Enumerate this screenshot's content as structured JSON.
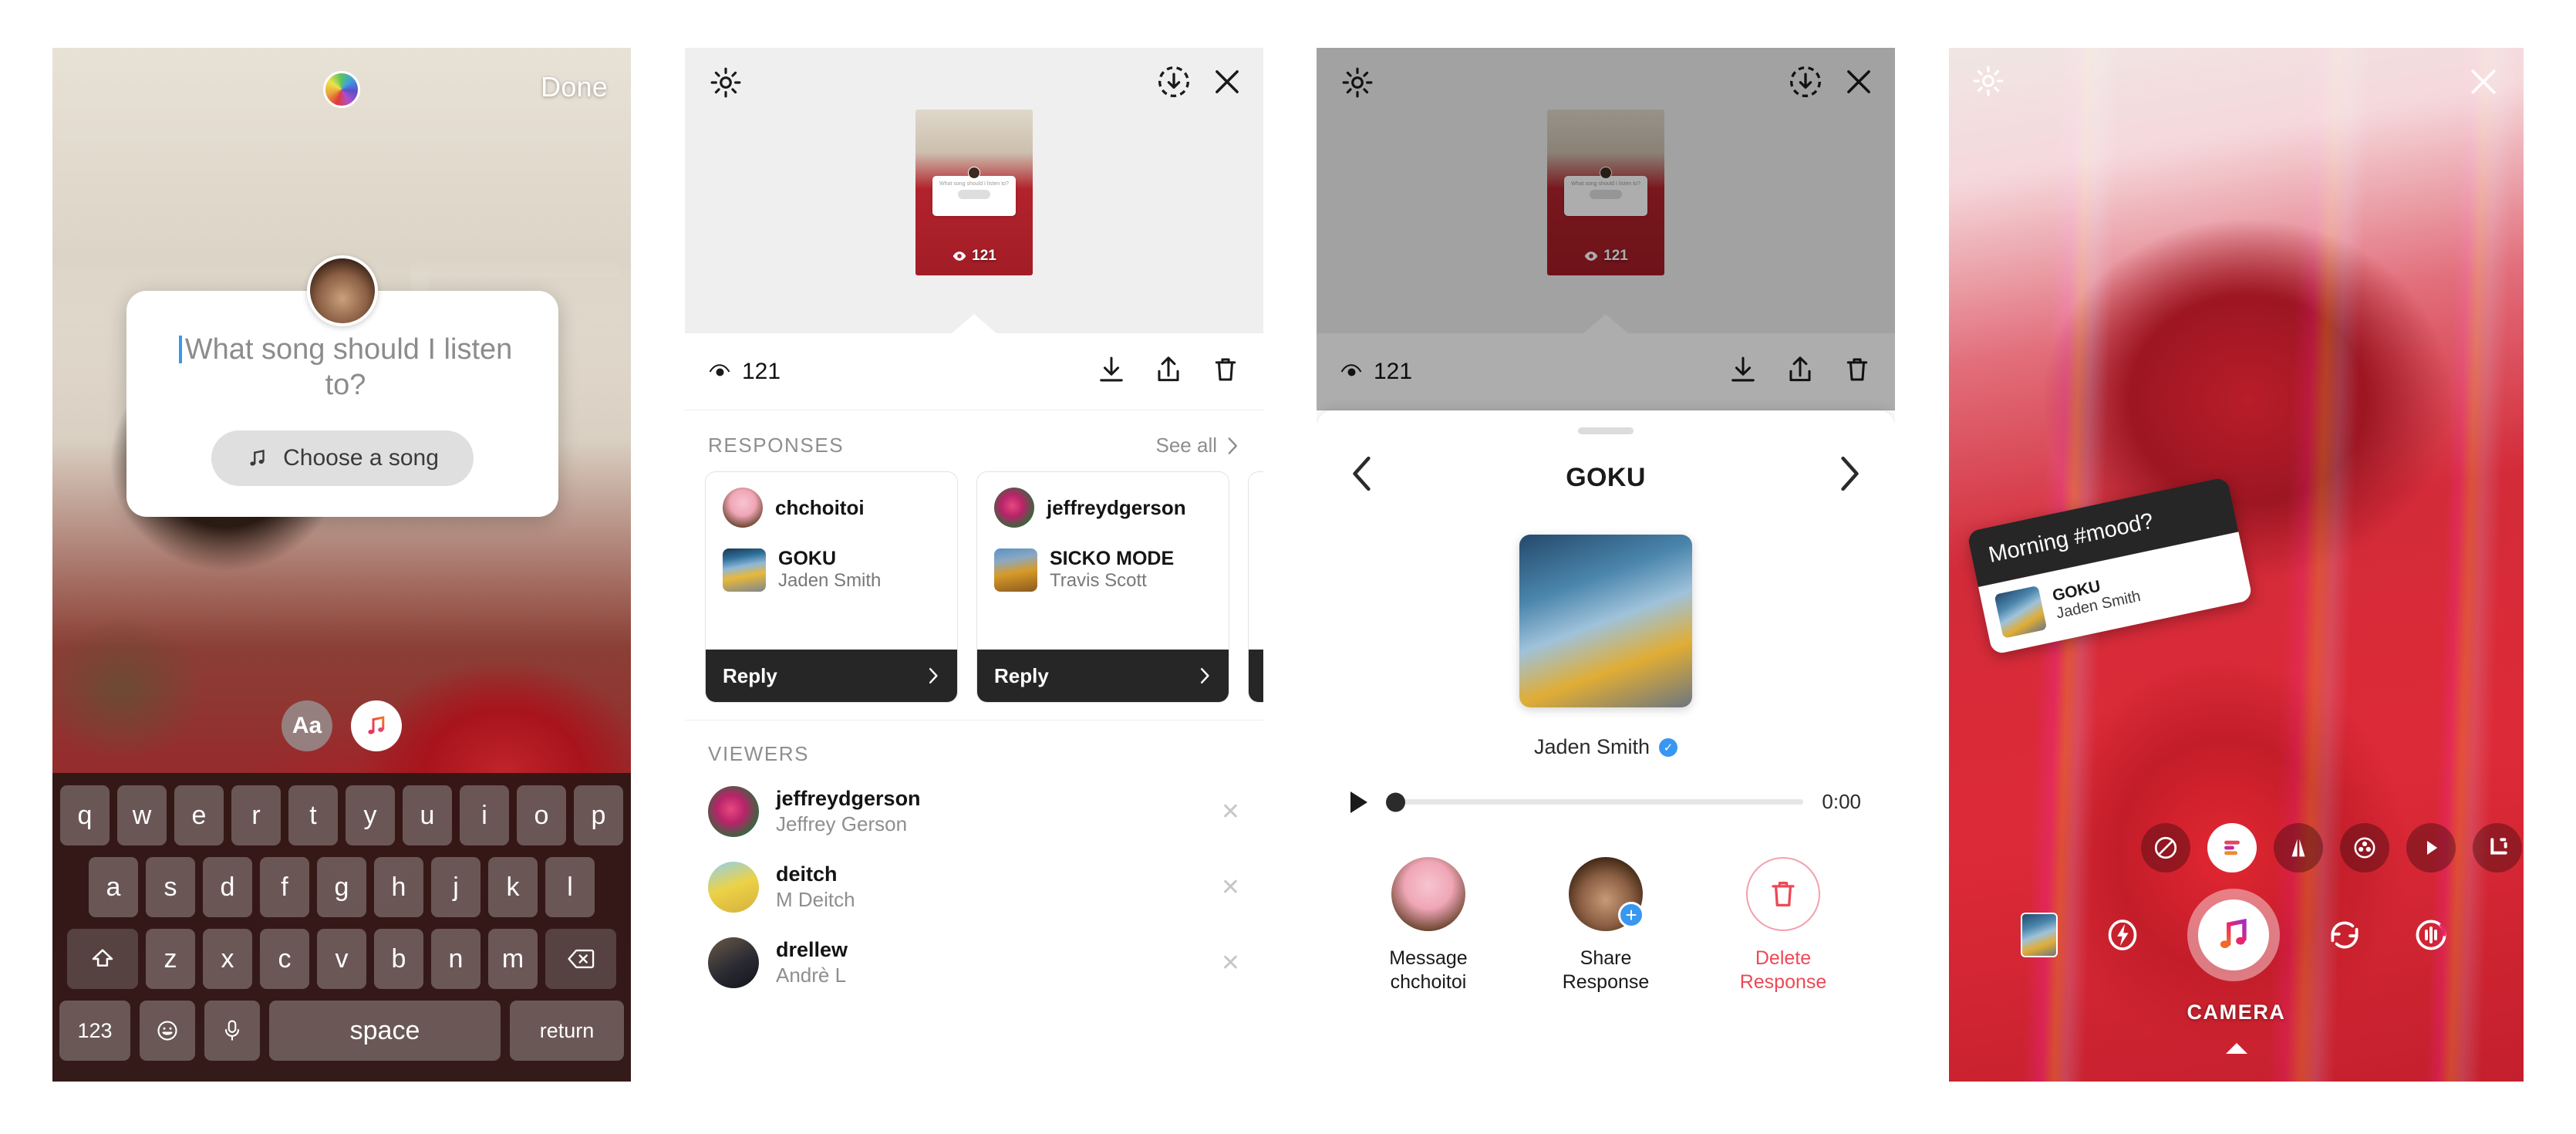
{
  "panel1": {
    "name": "story-editor-music-sticker",
    "done_label": "Done",
    "color_picker_icon": "rainbow-color-picker",
    "sticker": {
      "prompt_text": "What song should I listen to?",
      "choose_song_label": "Choose a song",
      "music_note_icon": "music-note-icon"
    },
    "tools": [
      {
        "label": "Aa",
        "name": "text-tool"
      },
      {
        "label": "",
        "name": "music-tool"
      }
    ],
    "keyboard": {
      "row1": [
        "q",
        "w",
        "e",
        "r",
        "t",
        "y",
        "u",
        "i",
        "o",
        "p"
      ],
      "row2": [
        "a",
        "s",
        "d",
        "f",
        "g",
        "h",
        "j",
        "k",
        "l"
      ],
      "row3": [
        "z",
        "x",
        "c",
        "v",
        "b",
        "n",
        "m"
      ],
      "shift_icon": "shift-arrow-icon",
      "backspace_icon": "backspace-icon",
      "numbers_label": "123",
      "emoji_icon": "emoji-icon",
      "mic_icon": "microphone-icon",
      "space_label": "space",
      "return_label": "return"
    }
  },
  "panel2": {
    "name": "story-insights-responses",
    "gear_icon": "settings-gear-icon",
    "download_circle_icon": "save-story-icon",
    "close_icon": "close-icon",
    "thumbnail": {
      "views_count": "121",
      "eye_icon": "views-eye-icon",
      "sticker_prompt": "What song should I listen to?"
    },
    "stat_bar": {
      "views_label": "121",
      "eye_icon": "views-eye-icon",
      "download_icon": "download-icon",
      "share_icon": "share-icon",
      "delete_icon": "trash-icon"
    },
    "responses": {
      "section_title": "RESPONSES",
      "see_all_label": "See all",
      "chevron_icon": "chevron-right-icon",
      "cards": [
        {
          "username": "chchoitoi",
          "song_title": "GOKU",
          "song_artist": "Jaden Smith",
          "reply_label": "Reply"
        },
        {
          "username": "jeffreydgerson",
          "song_title": "SICKO MODE",
          "song_artist": "Travis Scott",
          "reply_label": "Reply"
        },
        {
          "username": "",
          "song_title": "",
          "song_artist": "",
          "reply_label": ""
        }
      ]
    },
    "viewers": {
      "section_title": "VIEWERS",
      "remove_icon": "remove-viewer-icon",
      "list": [
        {
          "username": "jeffreydgerson",
          "fullname": "Jeffrey Gerson"
        },
        {
          "username": "deitch",
          "fullname": "M Deitch"
        },
        {
          "username": "drellew",
          "fullname": "Andrè L"
        }
      ]
    }
  },
  "panel3": {
    "name": "response-detail-sheet",
    "gear_icon": "settings-gear-icon",
    "download_circle_icon": "save-story-icon",
    "close_icon": "close-icon",
    "thumbnail": {
      "views_count": "121",
      "eye_icon": "views-eye-icon"
    },
    "stat_bar": {
      "views_label": "121",
      "download_icon": "download-icon",
      "share_icon": "share-icon",
      "delete_icon": "trash-icon"
    },
    "sheet": {
      "prev_icon": "chevron-left-icon",
      "next_icon": "chevron-right-icon",
      "song_title": "GOKU",
      "artist_name": "Jaden Smith",
      "verified_icon": "verified-badge-icon",
      "player": {
        "play_icon": "play-icon",
        "elapsed_time": "0:00",
        "progress_percent": 0
      },
      "actions": [
        {
          "name": "message-user-action",
          "label_line1": "Message",
          "label_line2": "chchoitoi",
          "style": "avatar"
        },
        {
          "name": "share-response-action",
          "label_line1": "Share",
          "label_line2": "Response",
          "style": "avatar-plus",
          "badge_icon": "plus-icon"
        },
        {
          "name": "delete-response-action",
          "label_line1": "Delete",
          "label_line2": "Response",
          "style": "danger",
          "icon": "trash-icon"
        }
      ]
    }
  },
  "panel4": {
    "name": "camera-music-mode",
    "gear_icon": "settings-gear-icon",
    "close_icon": "close-icon",
    "mood_sticker": {
      "caption": "Morning #mood?",
      "song_title": "GOKU",
      "song_artist": "Jaden Smith"
    },
    "effects": [
      {
        "name": "no-effect-filter",
        "icon": "no-effect-icon",
        "active": false
      },
      {
        "name": "music-effect-filter",
        "icon": "music-bars-icon",
        "active": true
      },
      {
        "name": "mirror-effect-filter",
        "icon": "mirror-icon",
        "active": false
      },
      {
        "name": "kaleidoscope-effect-filter",
        "icon": "kaleidoscope-icon",
        "active": false
      },
      {
        "name": "play-effect-filter",
        "icon": "play-icon",
        "active": false
      },
      {
        "name": "crop-effect-filter",
        "icon": "crop-icon",
        "active": false
      }
    ],
    "camera_controls": {
      "gallery_icon": "gallery-thumbnail",
      "flash_icon": "flash-icon",
      "shutter_icon": "music-note-icon",
      "flip_icon": "flip-camera-icon",
      "boomerang_icon": "audio-wave-icon"
    },
    "mode_label": "CAMERA",
    "mode_caret_icon": "mode-caret-icon"
  },
  "colors": {
    "accent_blue": "#3897f0",
    "danger_red": "#ed4956",
    "dark": "#262626",
    "muted": "#8e8e8e"
  }
}
